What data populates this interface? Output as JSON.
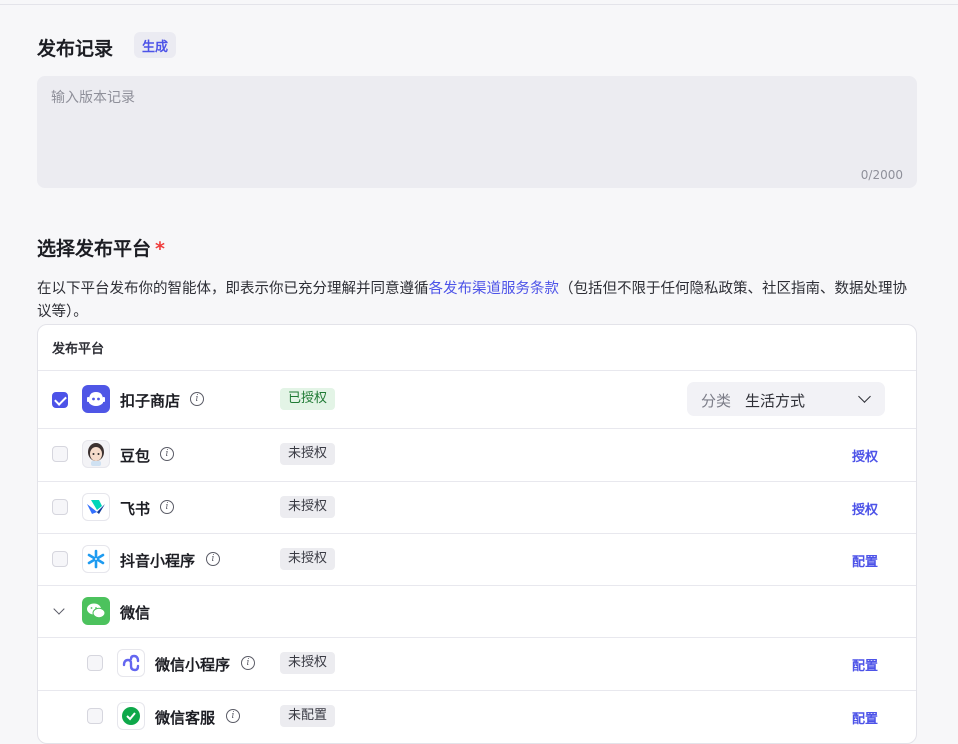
{
  "release": {
    "title": "发布记录",
    "generate_label": "生成",
    "placeholder": "输入版本记录",
    "counter": "0/2000"
  },
  "platform_section": {
    "title": "选择发布平台",
    "required_mark": "*",
    "desc_before": "在以下平台发布你的智能体，即表示你已充分理解并同意遵循",
    "desc_link": "各发布渠道服务条款",
    "desc_after": "（包括但不限于任何隐私政策、社区指南、数据处理协议等）。"
  },
  "table": {
    "header": "发布平台",
    "rows": {
      "store": {
        "name": "扣子商店",
        "status": "已授权",
        "checked": true,
        "category_label": "分类",
        "category_value": "生活方式"
      },
      "doubao": {
        "name": "豆包",
        "status": "未授权",
        "action": "授权"
      },
      "feishu": {
        "name": "飞书",
        "status": "未授权",
        "action": "授权"
      },
      "douyin": {
        "name": "抖音小程序",
        "status": "未授权",
        "action": "配置"
      },
      "wechat": {
        "name": "微信"
      },
      "wechat_mini": {
        "name": "微信小程序",
        "status": "未授权",
        "action": "配置"
      },
      "wechat_kf": {
        "name": "微信客服",
        "status": "未配置",
        "action": "配置"
      }
    }
  },
  "colors": {
    "accent": "#4d53e8",
    "authorized_bg": "#e3f4e6",
    "authorized_text": "#1f7a34",
    "required": "#f03b3b"
  }
}
